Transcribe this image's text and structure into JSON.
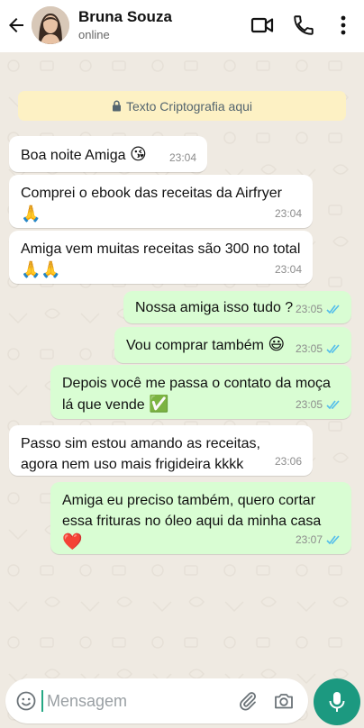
{
  "header": {
    "contact_name": "Bruna Souza",
    "status": "online",
    "icons": [
      "back-arrow-icon",
      "video-call-icon",
      "voice-call-icon",
      "more-options-icon"
    ]
  },
  "encryption_notice": "Texto Criptografia aqui",
  "messages": [
    {
      "direction": "in",
      "text": "Boa noite Amiga",
      "emoji": "😘",
      "time": "23:04"
    },
    {
      "direction": "in",
      "text": "Comprei o ebook das receitas da Airfryer",
      "emoji": "🙏",
      "time": "23:04"
    },
    {
      "direction": "in",
      "text": "Amiga vem muitas receitas são 300 no total",
      "emoji": "🙏🙏",
      "time": "23:04"
    },
    {
      "direction": "out",
      "text": "Nossa amiga isso tudo ?",
      "emoji": "",
      "time": "23:05",
      "status": "read"
    },
    {
      "direction": "out",
      "text": "Vou comprar também",
      "emoji": "😃",
      "time": "23:05",
      "status": "read"
    },
    {
      "direction": "out",
      "text": "Depois você me passa o contato da moça lá que vende",
      "emoji": "✅",
      "time": "23:05",
      "status": "read"
    },
    {
      "direction": "in",
      "text": "Passo sim estou amando as receitas, agora nem uso mais frigideira kkkk",
      "emoji": "",
      "time": "23:06"
    },
    {
      "direction": "out",
      "text": "Amiga eu preciso também, quero cortar essa frituras no óleo aqui da minha casa",
      "emoji": "❤️",
      "time": "23:07",
      "status": "read"
    }
  ],
  "composer": {
    "placeholder": "Mensagem",
    "value": ""
  },
  "colors": {
    "chat_background": "#efeae2",
    "outgoing_bubble": "#d9fdd3",
    "incoming_bubble": "#ffffff",
    "read_ticks": "#53bdeb",
    "mic_button": "#1c9980",
    "encryption_banner": "#fdf1c4"
  }
}
